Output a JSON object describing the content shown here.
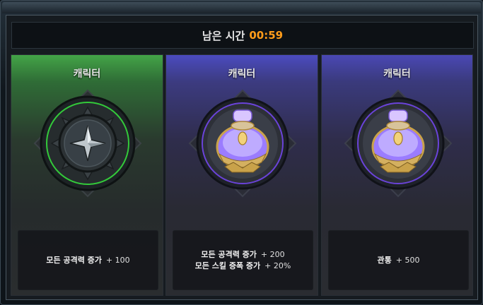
{
  "timer": {
    "label": "남은 시간",
    "value": "00:59"
  },
  "cards": [
    {
      "title": "캐릭터",
      "icon": "spiked-shield-emblem",
      "accent": "#3fbf3f",
      "effects": [
        {
          "text": "모든 공격력 증가",
          "value": "+ 100"
        }
      ]
    },
    {
      "title": "캐릭터",
      "icon": "purple-potion-emblem",
      "accent": "#6a5cff",
      "effects": [
        {
          "text": "모든 공격력 증가",
          "value": "+ 200"
        },
        {
          "text": "모든 스킬 증폭 증가",
          "value": "+ 20%"
        }
      ]
    },
    {
      "title": "캐릭터",
      "icon": "purple-potion-emblem",
      "accent": "#6a5cff",
      "effects": [
        {
          "text": "관통",
          "value": "+ 500"
        }
      ]
    }
  ]
}
